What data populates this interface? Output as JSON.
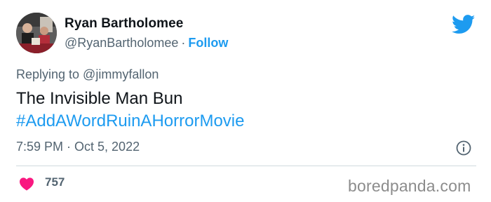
{
  "user": {
    "display_name": "Ryan Bartholomee",
    "handle": "@RyanBartholomee",
    "separator": "·",
    "follow_label": "Follow"
  },
  "tweet": {
    "replying_to": "Replying to @jimmyfallon",
    "text": "The Invisible Man Bun",
    "hashtag": "#AddAWordRuinAHorrorMovie",
    "timestamp": "7:59 PM · Oct 5, 2022"
  },
  "engagement": {
    "likes": "757"
  },
  "watermark": "boredpanda.com",
  "icons": {
    "brand": "twitter-bird-icon",
    "info": "info-icon",
    "like": "heart-icon"
  },
  "colors": {
    "accent": "#1d9bf0",
    "secondary_text": "#536471",
    "primary_text": "#0f1419",
    "heart": "#f91880",
    "divider": "#cfd9de"
  }
}
